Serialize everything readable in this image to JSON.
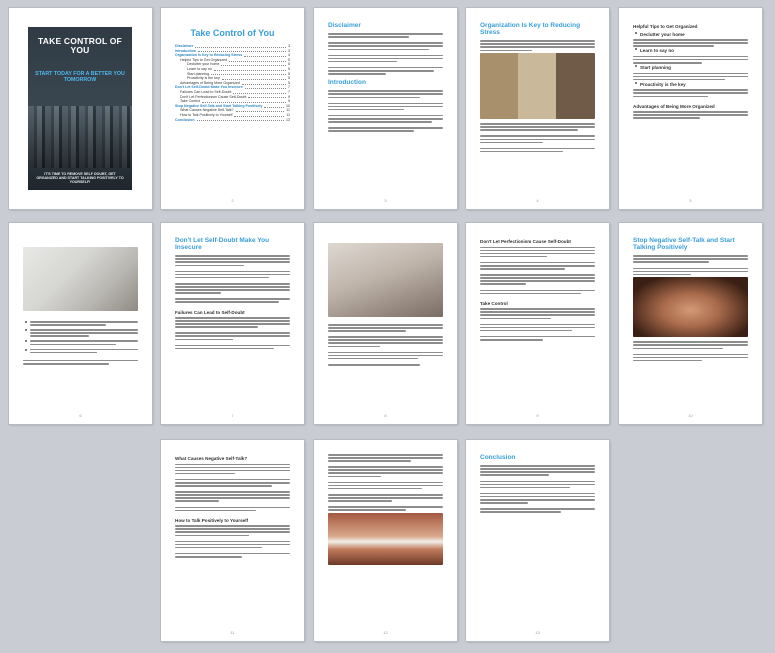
{
  "cover": {
    "title": "TAKE CONTROL OF YOU",
    "tagline": "START TODAY FOR A BETTER YOU TOMORROW",
    "blurb": "IT'S TIME TO REMOVE SELF DOUBT, GET ORGANIZED AND START TALKING POSITIVELY TO YOURSELF!"
  },
  "toc": {
    "title": "Take Control of You",
    "entries": [
      {
        "label": "Disclaimer",
        "page": "3",
        "level": "top"
      },
      {
        "label": "Introduction",
        "page": "3",
        "level": "top"
      },
      {
        "label": "Organization Is Key to Reducing Stress",
        "page": "4",
        "level": "top"
      },
      {
        "label": "Helpful Tips to Get Organized",
        "page": "5",
        "level": "l1"
      },
      {
        "label": "Declutter your home",
        "page": "5",
        "level": "l2"
      },
      {
        "label": "Learn to say no",
        "page": "5",
        "level": "l2"
      },
      {
        "label": "Start planning",
        "page": "5",
        "level": "l2"
      },
      {
        "label": "Proactivity is the key",
        "page": "5",
        "level": "l2"
      },
      {
        "label": "Advantages of Being More Organized",
        "page": "5",
        "level": "l1"
      },
      {
        "label": "Don't Let Self-Doubt Make You Insecure",
        "page": "7",
        "level": "top"
      },
      {
        "label": "Failures Can Lead to Self-Doubt",
        "page": "7",
        "level": "l1"
      },
      {
        "label": "Don't Let Perfectionism Cause Self-Doubt",
        "page": "9",
        "level": "l1"
      },
      {
        "label": "Take Control",
        "page": "9",
        "level": "l1"
      },
      {
        "label": "Stop Negative Self-Talk and Start Talking Positively",
        "page": "10",
        "level": "top"
      },
      {
        "label": "What Causes Negative Self-Talk?",
        "page": "11",
        "level": "l1"
      },
      {
        "label": "How to Talk Positively to Yourself",
        "page": "11",
        "level": "l1"
      },
      {
        "label": "Conclusion",
        "page": "13",
        "level": "top"
      }
    ]
  },
  "pages": {
    "p3": {
      "heading1": "Disclaimer",
      "heading2": "Introduction",
      "num": "3"
    },
    "p4": {
      "heading": "Organization Is Key to Reducing Stress",
      "num": "4"
    },
    "p5": {
      "sub1": "Helpful Tips to Get Organized",
      "b1": "Declutter your home",
      "b2": "Learn to say no",
      "b3": "Start planning",
      "b4": "Proactivity is the key",
      "sub2": "Advantages of Being More Organized",
      "num": "5"
    },
    "p6": {
      "num": "6"
    },
    "p7": {
      "heading": "Don't Let Self-Doubt Make You Insecure",
      "sub": "Failures Can Lead to Self-Doubt",
      "num": "7"
    },
    "p8": {
      "num": "8"
    },
    "p9": {
      "sub1": "Don't Let Perfectionism Cause Self-Doubt",
      "sub2": "Take Control",
      "num": "9"
    },
    "p10": {
      "heading": "Stop Negative Self-Talk and Start Talking Positively",
      "num": "10"
    },
    "p11": {
      "sub1": "What Causes Negative Self-Talk?",
      "sub2": "How to Talk Positively to Yourself",
      "num": "11"
    },
    "p12": {
      "num": "12"
    },
    "p13": {
      "heading": "Conclusion",
      "num": "13"
    }
  }
}
